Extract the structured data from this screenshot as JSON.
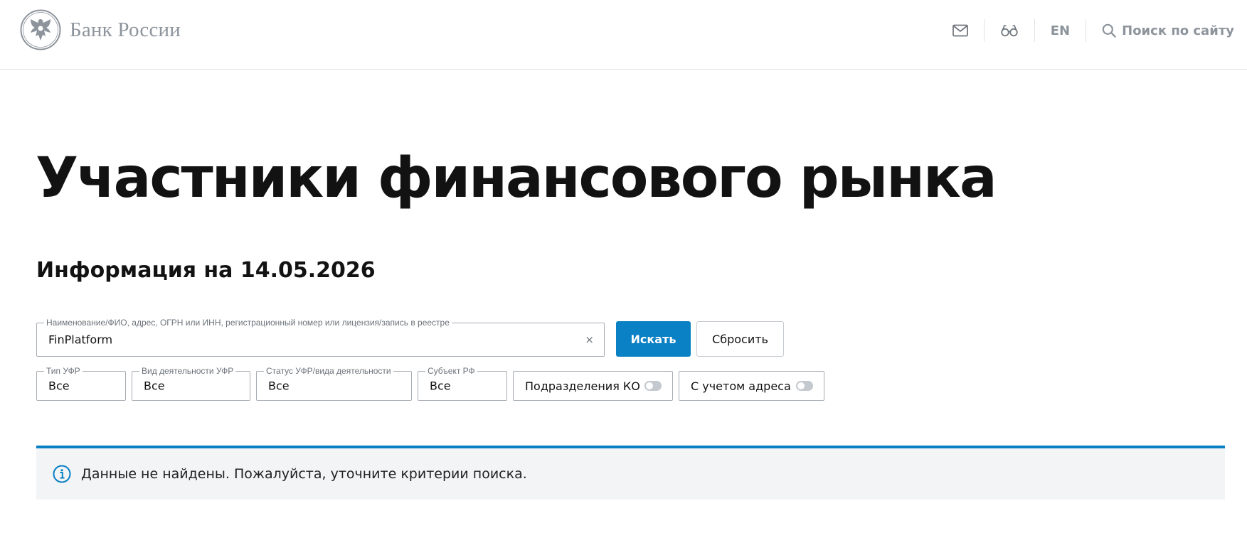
{
  "header": {
    "logo_text": "Банк России",
    "lang_label": "EN",
    "search_label": "Поиск по сайту",
    "icons": [
      "mail-icon",
      "glasses-icon",
      "search-icon"
    ]
  },
  "page": {
    "title": "Участники финансового рынка",
    "info_date": "Информация на 14.05.2026"
  },
  "search": {
    "label": "Наименование/ФИО, адрес, ОГРН или ИНН, регистрационный номер или лицензия/запись в реестре",
    "value": "FinPlatform",
    "clear_glyph": "×",
    "submit_label": "Искать",
    "reset_label": "Сбросить"
  },
  "filters": {
    "type": {
      "label": "Тип УФР",
      "value": "Все"
    },
    "activity": {
      "label": "Вид деятельности УФР",
      "value": "Все"
    },
    "status": {
      "label": "Статус УФР/вида деятельности",
      "value": "Все"
    },
    "region": {
      "label": "Субъект РФ",
      "value": "Все"
    },
    "branches_toggle": {
      "label": "Подразделения КО",
      "on": false
    },
    "address_toggle": {
      "label": "С учетом адреса",
      "on": false
    }
  },
  "notice": {
    "text": "Данные не найдены. Пожалуйста, уточните критерии поиска.",
    "icon": "info-icon"
  },
  "colors": {
    "accent": "#0a80c5",
    "muted": "#8d949c",
    "notice_bg": "#f3f4f5"
  }
}
